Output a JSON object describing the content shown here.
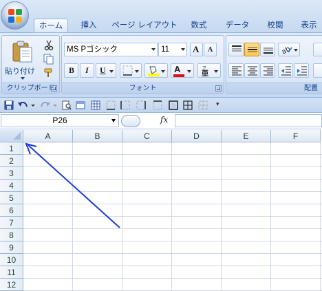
{
  "ribbon": {
    "tabs": [
      {
        "label": "ホーム",
        "active": true
      },
      {
        "label": "挿入",
        "active": false
      },
      {
        "label": "ページ レイアウト",
        "active": false
      },
      {
        "label": "数式",
        "active": false
      },
      {
        "label": "データ",
        "active": false
      },
      {
        "label": "校閲",
        "active": false
      },
      {
        "label": "表示",
        "active": false
      }
    ],
    "clipboard": {
      "paste_label": "貼り付け",
      "group_label": "クリップボード"
    },
    "font": {
      "family": "MS Pゴシック",
      "size": "11",
      "group_label": "フォント",
      "bold": "B",
      "italic": "I",
      "underline": "U",
      "grow": "A",
      "shrink": "A"
    },
    "alignment": {
      "group_label": "配置"
    }
  },
  "formula_bar": {
    "name_box": "P26",
    "fx_label": "fx",
    "value": ""
  },
  "sheet": {
    "columns": [
      "A",
      "B",
      "C",
      "D",
      "E",
      "F"
    ],
    "rows": [
      "1",
      "2",
      "3",
      "4",
      "5",
      "6",
      "7",
      "8",
      "9",
      "10",
      "11",
      "12"
    ]
  },
  "colors": {
    "accent": "#1f3bd6",
    "ribbon": "#dbe8f8",
    "font_color_bar": "#e01010",
    "fill_color_bar": "#ffff00"
  }
}
